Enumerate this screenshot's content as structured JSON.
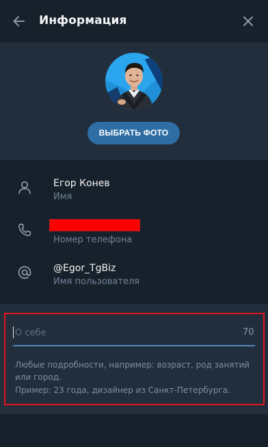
{
  "header": {
    "title": "Информация"
  },
  "photo": {
    "choose_button": "ВЫБРАТЬ ФОТО"
  },
  "profile": {
    "name": "Егор Конев",
    "name_label": "Имя",
    "phone_label": "Номер телефона",
    "username": "@Egor_TgBiz",
    "username_label": "Имя пользователя"
  },
  "about": {
    "placeholder": "О себе",
    "counter": "70",
    "hint_line1": "Любые подробности, например: возраст, род занятий",
    "hint_line2": "или город.",
    "hint_line3": "Пример: 23 года, дизайнер из Санкт-Петербурга."
  },
  "icons": {
    "back": "arrow-left-icon",
    "close": "close-icon",
    "name": "user-icon",
    "phone": "phone-icon",
    "username": "at-sign-icon"
  },
  "colors": {
    "background": "#17212b",
    "panel": "#232e3c",
    "accent": "#2f6ea5",
    "input_underline": "#5288c1",
    "highlight": "#e0151f",
    "redaction": "#ff0000"
  }
}
